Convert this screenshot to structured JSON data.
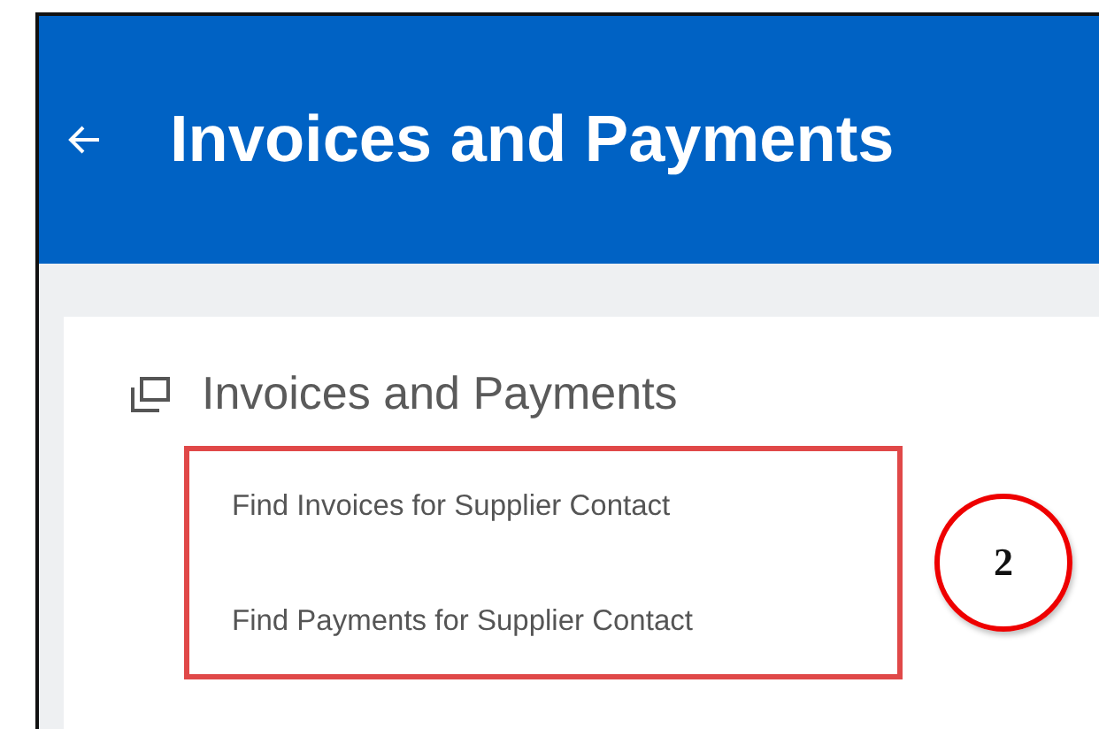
{
  "header": {
    "title": "Invoices and Payments"
  },
  "section": {
    "title": "Invoices and Payments",
    "links": [
      "Find Invoices for Supplier Contact",
      "Find Payments for Supplier Contact"
    ]
  },
  "annotation": {
    "callout": "2"
  }
}
